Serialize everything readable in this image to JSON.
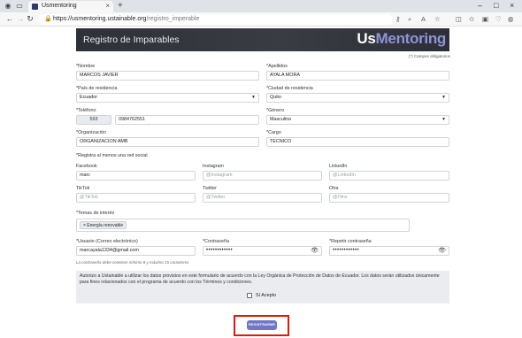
{
  "browser": {
    "tab_title": "Usmentoring",
    "url_host": "https://usmentoring.ustainable.org",
    "url_path": "/registro_imperable"
  },
  "icons": {
    "back": "back-arrow-icon",
    "forward": "forward-arrow-icon",
    "reload": "reload-icon",
    "lock": "lock-icon"
  },
  "page": {
    "title": "Registro de Imparables",
    "logo_us": "Us",
    "logo_mentoring": "Mentoring",
    "required_note": "(*) Campos obligatorios",
    "brand_color": "#8f93d8"
  },
  "form": {
    "nombre_label": "*Nombre",
    "nombre_value": "MARCOS JAVIER",
    "apellidos_label": "*Apellidos",
    "apellidos_value": "AYALA MORA",
    "pais_label": "*País de residencia",
    "pais_value": "Ecuador",
    "ciudad_label": "*Ciudad de residencia",
    "ciudad_value": "Quito",
    "telefono_label": "*Teléfono",
    "telefono_prefix": "593",
    "telefono_value": "0984762551",
    "genero_label": "*Género",
    "genero_value": "Masculino",
    "organizacion_label": "*Organización",
    "organizacion_value": "ORGANIZACION AMB",
    "cargo_label": "*Cargo",
    "cargo_value": "TECNICO",
    "social_label": "*Registra al menos una red social",
    "facebook_label": "Facebook",
    "facebook_value": "marc",
    "instagram_label": "Instagram",
    "instagram_placeholder": "@Instagram",
    "linkedin_label": "LinkedIn",
    "linkedin_placeholder": "@LinkedIn",
    "tiktok_label": "TikTok",
    "tiktok_placeholder": "@TikTok",
    "twitter_label": "Twitter",
    "twitter_placeholder": "@Twitter",
    "otra_label": "Otra",
    "otra_placeholder": "@Otra",
    "temas_label": "*Temas de interés",
    "tema_chip": "× Energía renovable",
    "usuario_label": "*Usuario (Correo electrónico)",
    "usuario_value": "marcayala1334@gmail.com",
    "contrasena_label": "*Contraseña",
    "contrasena_value": "••••••••••••",
    "repetir_label": "*Repetir contraseña",
    "repetir_value": "••••••••••••",
    "password_hint": "La contraseña debe contener mínimo 8 y máximo 15 caracteres",
    "consent_text": "Autorizo a Ustainable a utilizar los datos provistos en este formulario de acuerdo con la Ley Orgánica de Protección de Datos de Ecuador. Los datos serán utilizados únicamente para fines relacionados con el programa de acuerdo con los Términos y condiciones.",
    "consent_checkbox_label": "Sí Acepto",
    "submit_label": "REGISTRARME"
  }
}
